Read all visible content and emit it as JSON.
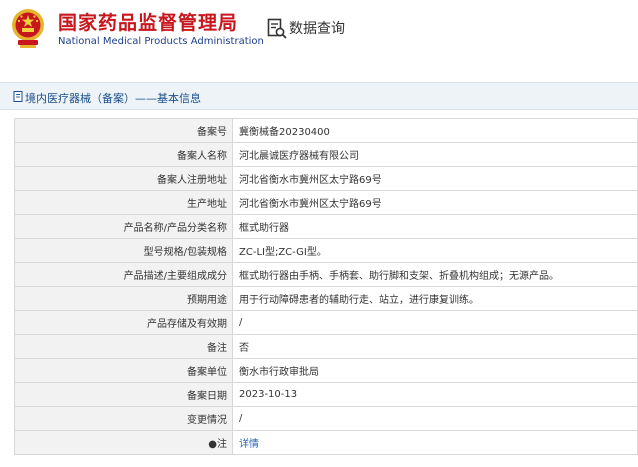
{
  "header": {
    "site_name_cn": "国家药品监督管理局",
    "site_name_en": "National Medical Products Administration",
    "query_title": "数据查询",
    "brand_red": "#c8161d",
    "brand_blue": "#1d3f8c"
  },
  "breadcrumb": {
    "text": "境内医疗器械（备案）——基本信息"
  },
  "record": {
    "rows": [
      {
        "label": "备案号",
        "value": "冀衡械备20230400"
      },
      {
        "label": "备案人名称",
        "value": "河北晨诚医疗器械有限公司"
      },
      {
        "label": "备案人注册地址",
        "value": "河北省衡水市冀州区太宁路69号"
      },
      {
        "label": "生产地址",
        "value": "河北省衡水市冀州区太宁路69号"
      },
      {
        "label": "产品名称/产品分类名称",
        "value": "框式助行器"
      },
      {
        "label": "型号规格/包装规格",
        "value": "ZC-LI型;ZC-GI型。"
      },
      {
        "label": "产品描述/主要组成成分",
        "value": "框式助行器由手柄、手柄套、助行脚和支架、折叠机构组成；无源产品。"
      },
      {
        "label": "预期用途",
        "value": "用于行动障碍患者的辅助行走、站立，进行康复训练。"
      },
      {
        "label": "产品存储及有效期",
        "value": "/"
      },
      {
        "label": "备注",
        "value": "否"
      },
      {
        "label": "备案单位",
        "value": "衡水市行政审批局"
      },
      {
        "label": "备案日期",
        "value": "2023-10-13"
      },
      {
        "label": "变更情况",
        "value": "/"
      }
    ],
    "note_label": "注",
    "note_link": "详情"
  }
}
